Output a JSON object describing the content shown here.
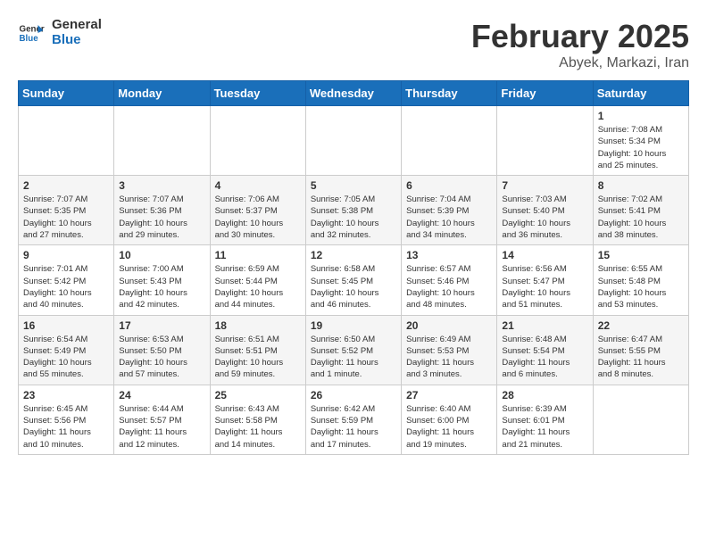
{
  "logo": {
    "line1": "General",
    "line2": "Blue"
  },
  "title": "February 2025",
  "subtitle": "Abyek, Markazi, Iran",
  "weekdays": [
    "Sunday",
    "Monday",
    "Tuesday",
    "Wednesday",
    "Thursday",
    "Friday",
    "Saturday"
  ],
  "weeks": [
    [
      {
        "day": "",
        "info": ""
      },
      {
        "day": "",
        "info": ""
      },
      {
        "day": "",
        "info": ""
      },
      {
        "day": "",
        "info": ""
      },
      {
        "day": "",
        "info": ""
      },
      {
        "day": "",
        "info": ""
      },
      {
        "day": "1",
        "info": "Sunrise: 7:08 AM\nSunset: 5:34 PM\nDaylight: 10 hours\nand 25 minutes."
      }
    ],
    [
      {
        "day": "2",
        "info": "Sunrise: 7:07 AM\nSunset: 5:35 PM\nDaylight: 10 hours\nand 27 minutes."
      },
      {
        "day": "3",
        "info": "Sunrise: 7:07 AM\nSunset: 5:36 PM\nDaylight: 10 hours\nand 29 minutes."
      },
      {
        "day": "4",
        "info": "Sunrise: 7:06 AM\nSunset: 5:37 PM\nDaylight: 10 hours\nand 30 minutes."
      },
      {
        "day": "5",
        "info": "Sunrise: 7:05 AM\nSunset: 5:38 PM\nDaylight: 10 hours\nand 32 minutes."
      },
      {
        "day": "6",
        "info": "Sunrise: 7:04 AM\nSunset: 5:39 PM\nDaylight: 10 hours\nand 34 minutes."
      },
      {
        "day": "7",
        "info": "Sunrise: 7:03 AM\nSunset: 5:40 PM\nDaylight: 10 hours\nand 36 minutes."
      },
      {
        "day": "8",
        "info": "Sunrise: 7:02 AM\nSunset: 5:41 PM\nDaylight: 10 hours\nand 38 minutes."
      }
    ],
    [
      {
        "day": "9",
        "info": "Sunrise: 7:01 AM\nSunset: 5:42 PM\nDaylight: 10 hours\nand 40 minutes."
      },
      {
        "day": "10",
        "info": "Sunrise: 7:00 AM\nSunset: 5:43 PM\nDaylight: 10 hours\nand 42 minutes."
      },
      {
        "day": "11",
        "info": "Sunrise: 6:59 AM\nSunset: 5:44 PM\nDaylight: 10 hours\nand 44 minutes."
      },
      {
        "day": "12",
        "info": "Sunrise: 6:58 AM\nSunset: 5:45 PM\nDaylight: 10 hours\nand 46 minutes."
      },
      {
        "day": "13",
        "info": "Sunrise: 6:57 AM\nSunset: 5:46 PM\nDaylight: 10 hours\nand 48 minutes."
      },
      {
        "day": "14",
        "info": "Sunrise: 6:56 AM\nSunset: 5:47 PM\nDaylight: 10 hours\nand 51 minutes."
      },
      {
        "day": "15",
        "info": "Sunrise: 6:55 AM\nSunset: 5:48 PM\nDaylight: 10 hours\nand 53 minutes."
      }
    ],
    [
      {
        "day": "16",
        "info": "Sunrise: 6:54 AM\nSunset: 5:49 PM\nDaylight: 10 hours\nand 55 minutes."
      },
      {
        "day": "17",
        "info": "Sunrise: 6:53 AM\nSunset: 5:50 PM\nDaylight: 10 hours\nand 57 minutes."
      },
      {
        "day": "18",
        "info": "Sunrise: 6:51 AM\nSunset: 5:51 PM\nDaylight: 10 hours\nand 59 minutes."
      },
      {
        "day": "19",
        "info": "Sunrise: 6:50 AM\nSunset: 5:52 PM\nDaylight: 11 hours\nand 1 minute."
      },
      {
        "day": "20",
        "info": "Sunrise: 6:49 AM\nSunset: 5:53 PM\nDaylight: 11 hours\nand 3 minutes."
      },
      {
        "day": "21",
        "info": "Sunrise: 6:48 AM\nSunset: 5:54 PM\nDaylight: 11 hours\nand 6 minutes."
      },
      {
        "day": "22",
        "info": "Sunrise: 6:47 AM\nSunset: 5:55 PM\nDaylight: 11 hours\nand 8 minutes."
      }
    ],
    [
      {
        "day": "23",
        "info": "Sunrise: 6:45 AM\nSunset: 5:56 PM\nDaylight: 11 hours\nand 10 minutes."
      },
      {
        "day": "24",
        "info": "Sunrise: 6:44 AM\nSunset: 5:57 PM\nDaylight: 11 hours\nand 12 minutes."
      },
      {
        "day": "25",
        "info": "Sunrise: 6:43 AM\nSunset: 5:58 PM\nDaylight: 11 hours\nand 14 minutes."
      },
      {
        "day": "26",
        "info": "Sunrise: 6:42 AM\nSunset: 5:59 PM\nDaylight: 11 hours\nand 17 minutes."
      },
      {
        "day": "27",
        "info": "Sunrise: 6:40 AM\nSunset: 6:00 PM\nDaylight: 11 hours\nand 19 minutes."
      },
      {
        "day": "28",
        "info": "Sunrise: 6:39 AM\nSunset: 6:01 PM\nDaylight: 11 hours\nand 21 minutes."
      },
      {
        "day": "",
        "info": ""
      }
    ]
  ]
}
